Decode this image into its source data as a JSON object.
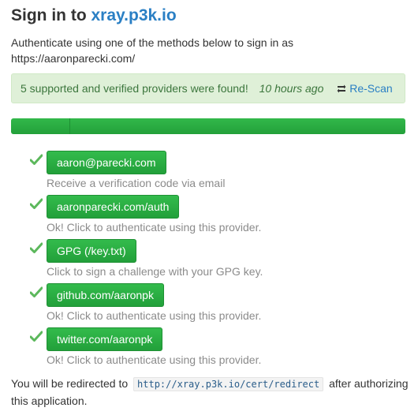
{
  "page": {
    "title_prefix": "Sign in to",
    "title_site": "xray.p3k.io",
    "intro_line1": "Authenticate using one of the methods below to sign in as",
    "intro_line2": "https://aaronparecki.com/"
  },
  "alert": {
    "message": "5 supported and verified providers were found!",
    "time": "10 hours ago",
    "rescan_label": "Re-Scan",
    "rescan_icon": "refresh-icon"
  },
  "progress": {
    "segments": [
      0.15,
      0.85
    ]
  },
  "providers": [
    {
      "label": "aaron@parecki.com",
      "description": "Receive a verification code via email",
      "status_icon": "check-icon"
    },
    {
      "label": "aaronparecki.com/auth",
      "description": "Ok! Click to authenticate using this provider.",
      "status_icon": "check-icon"
    },
    {
      "label": "GPG (/key.txt)",
      "description": "Click to sign a challenge with your GPG key.",
      "status_icon": "check-icon"
    },
    {
      "label": "github.com/aaronpk",
      "description": "Ok! Click to authenticate using this provider.",
      "status_icon": "check-icon"
    },
    {
      "label": "twitter.com/aaronpk",
      "description": "Ok! Click to authenticate using this provider.",
      "status_icon": "check-icon"
    }
  ],
  "footer": {
    "before": "You will be redirected to",
    "redirect_url": "http://xray.p3k.io/cert/redirect",
    "after_line1": "after authorizing",
    "after_line2": "this application."
  },
  "colors": {
    "link": "#2a7fc4",
    "success_bg": "#dff0d8",
    "success_text": "#3c763d",
    "button_green": "#28a745",
    "check_green": "#5cb85c"
  }
}
